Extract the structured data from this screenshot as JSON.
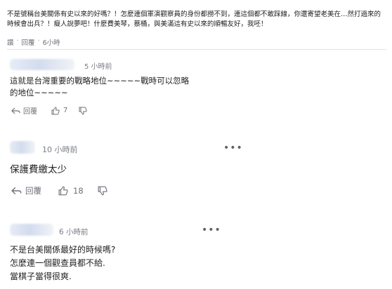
{
  "top_comment": {
    "text": "不是號稱台美關係有史以來的好嗎？！怎麼連個軍演觀察員的身份都撈不到，連這個都不敢踩線，你還寄望老美在…然打過來的時候會出兵？！癡人說夢吧！什麼費美琴，蔡桶，與美滿這有史以來的順暢友好，我呸！",
    "reply_label": "讚",
    "reply2_label": "回覆",
    "time": "6小時"
  },
  "comments": [
    {
      "time": "5 小時前",
      "text_line1": "這就是台灣重要的戰略地位~~~~~戰時可以忽略",
      "text_line2": "的地位~~~~~",
      "reply_label": "回覆",
      "likes": "7"
    },
    {
      "time": "10 小時前",
      "text_line1": "保護費繳太少",
      "reply_label": "回覆",
      "likes": "18"
    },
    {
      "time": "6 小時前",
      "text_line1": "不是台美關係最好的時候嗎?",
      "text_line2": "怎麼連一個觀查員都不給.",
      "text_line3": "當棋子當得很爽."
    }
  ],
  "more_label": "•••",
  "icons": {
    "reply": "reply-arrow-icon",
    "like": "thumbs-up-icon",
    "dislike": "thumbs-down-icon",
    "more": "more-dots-icon"
  }
}
